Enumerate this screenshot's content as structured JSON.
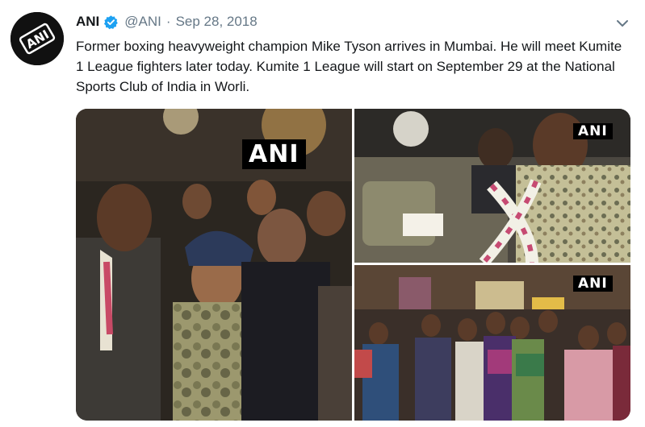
{
  "account": {
    "name": "ANI",
    "handle": "@ANI",
    "separator": "·",
    "date": "Sep 28, 2018",
    "avatar_icon": "ani-logo",
    "verified_icon": "verified-badge-icon"
  },
  "tweet": {
    "text": "Former boxing heavyweight champion Mike Tyson arrives in Mumbai. He will meet Kumite 1 League fighters later today. Kumite 1 League will start on September 29 at the National Sports Club of India in Worli."
  },
  "media": {
    "watermark": "ANI",
    "photos": [
      "crowd-arrival-photo",
      "car-garland-photo",
      "fans-posters-photo"
    ]
  },
  "colors": {
    "text": "#14171a",
    "secondary": "#657786",
    "verified": "#1da1f2"
  }
}
